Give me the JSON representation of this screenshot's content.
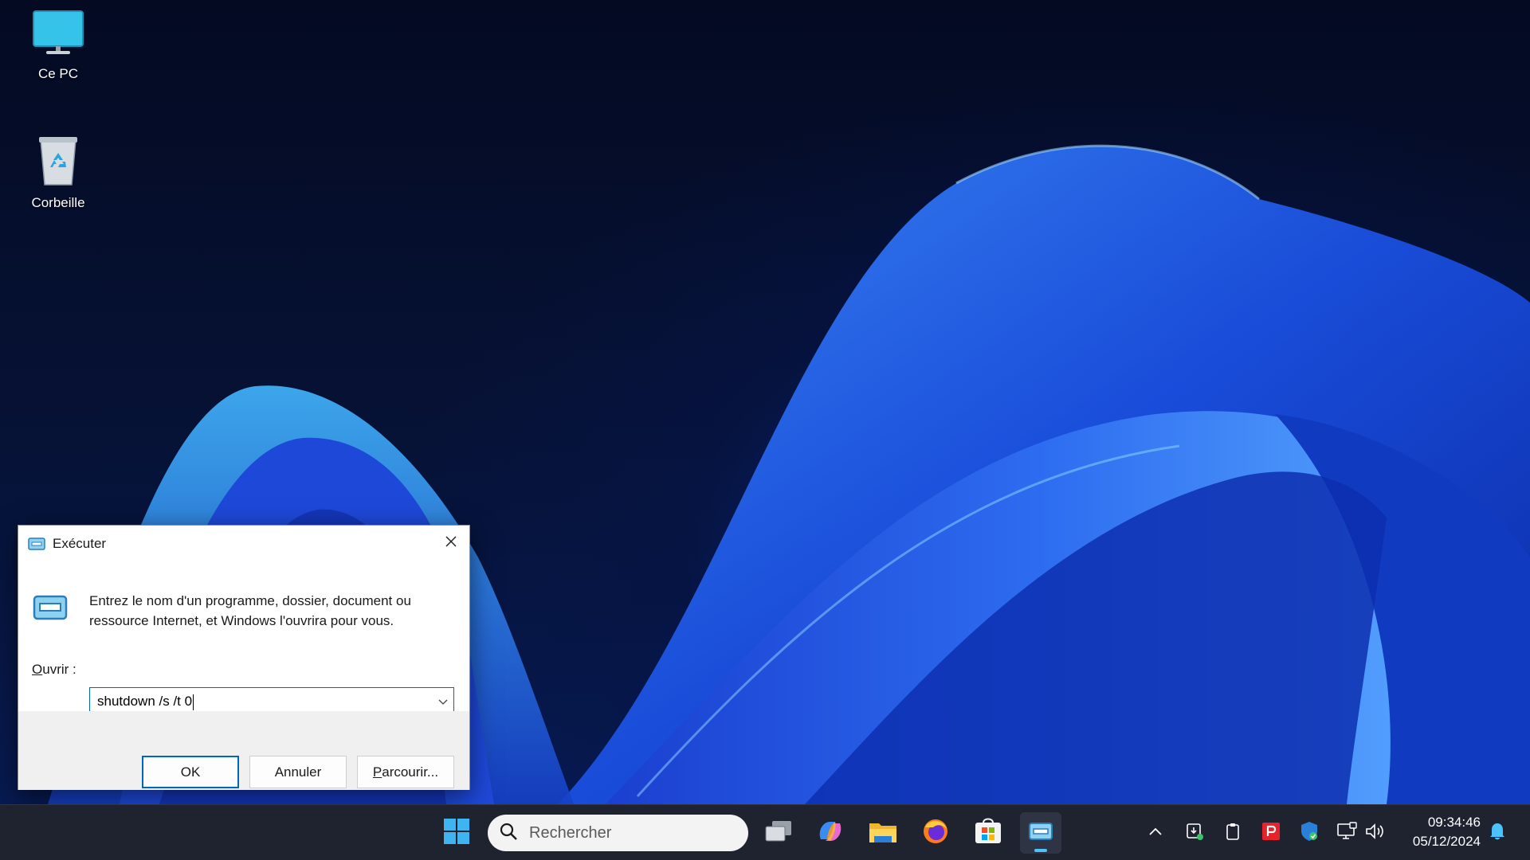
{
  "desktop": {
    "icons": [
      {
        "label": "Ce PC",
        "icon": "monitor-icon"
      },
      {
        "label": "Corbeille",
        "icon": "recycle-bin-icon"
      }
    ]
  },
  "run_dialog": {
    "title": "Exécuter",
    "description": "Entrez le nom d'un programme, dossier, document ou ressource Internet, et Windows l'ouvrira pour vous.",
    "open_label_prefix": "O",
    "open_label_rest": "uvrir :",
    "input_value": "shutdown /s /t 0",
    "buttons": {
      "ok": "OK",
      "cancel": "Annuler",
      "browse_underlined": "P",
      "browse_rest": "arcourir..."
    }
  },
  "taskbar": {
    "search_placeholder": "Rechercher",
    "apps": [
      "start-icon",
      "task-view-icon",
      "copilot-icon",
      "file-explorer-icon",
      "firefox-icon",
      "microsoft-store-icon",
      "run-app-icon"
    ],
    "active_app": "run-app-icon",
    "tray": [
      "show-hidden-icons-chevron",
      "download-status-icon",
      "clipboard-icon",
      "pdf-app-icon",
      "windows-security-icon",
      "network-icon",
      "volume-icon"
    ],
    "time": "09:34:46",
    "date": "05/12/2024"
  },
  "colors": {
    "accent": "#0067c0",
    "taskbar_bg": "#1f2330",
    "active_indicator": "#4cc2ff"
  }
}
